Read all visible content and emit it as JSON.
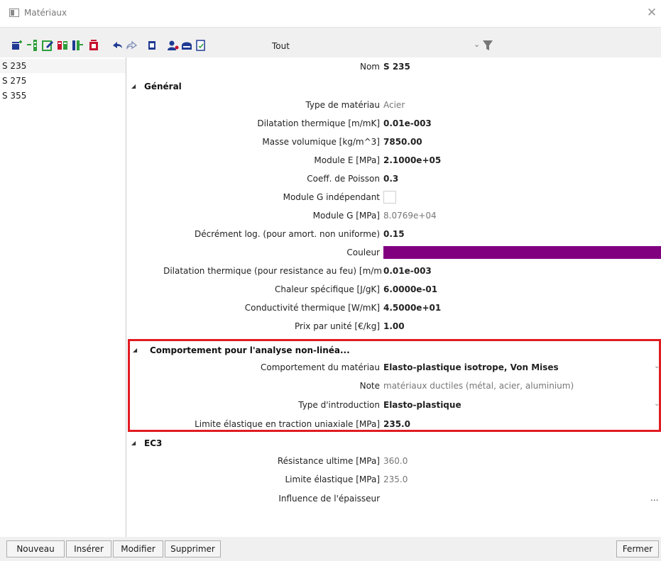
{
  "window": {
    "title": "Matériaux",
    "close_icon": "close-icon"
  },
  "toolbar": {
    "icons": [
      "add-material-icon",
      "insert-icon",
      "edit-icon",
      "copy-icon",
      "append-icon",
      "delete-icon",
      "undo-icon",
      "redo-icon",
      "trash-icon",
      "user-settings-icon",
      "save-icon",
      "document-icon"
    ],
    "filter_value": "Tout"
  },
  "list": {
    "items": [
      "S 235",
      "S 275",
      "S 355"
    ],
    "selected": "S 235"
  },
  "props": {
    "nom": {
      "label": "Nom",
      "value": "S 235"
    },
    "general": {
      "title": "Général",
      "type_materiau": {
        "label": "Type de matériau",
        "value": "Acier"
      },
      "dilatation": {
        "label": "Dilatation thermique  [m/mK]",
        "value": "0.01e-003"
      },
      "masse": {
        "label": "Masse volumique [kg/m^3]",
        "value": "7850.00"
      },
      "module_e": {
        "label": "Module E [MPa]",
        "value": "2.1000e+05"
      },
      "poisson": {
        "label": "Coeff. de Poisson",
        "value": "0.3"
      },
      "g_indep": {
        "label": "Module G indépendant"
      },
      "module_g": {
        "label": "Module G [MPa]",
        "value": "8.0769e+04"
      },
      "decrement": {
        "label": "Décrément log. (pour amort. non uniforme)",
        "value": "0.15"
      },
      "couleur": {
        "label": "Couleur",
        "color": "#800080"
      },
      "dilatation_feu": {
        "label": "Dilatation thermique (pour resistance au feu)  [m/m",
        "value": "0.01e-003"
      },
      "chaleur": {
        "label": "Chaleur spécifique [J/gK]",
        "value": "6.0000e-01"
      },
      "conductivite": {
        "label": "Conductivité thermique [W/mK]",
        "value": "4.5000e+01"
      },
      "prix": {
        "label": "Prix par unité [€/kg]",
        "value": "1.00"
      }
    },
    "nonlin": {
      "title": "Comportement pour l'analyse non-linéa...",
      "comportement": {
        "label": "Comportement du matériau",
        "value": "Elasto-plastique isotrope, Von Mises"
      },
      "note": {
        "label": "Note",
        "value": "matériaux ductiles (métal, acier, aluminium)"
      },
      "type_intro": {
        "label": "Type d'introduction",
        "value": "Elasto-plastique"
      },
      "limite_traction": {
        "label": "Limite élastique en traction uniaxiale [MPa]",
        "value": "235.0"
      }
    },
    "ec3": {
      "title": "EC3",
      "resistance": {
        "label": "Résistance ultime [MPa]",
        "value": "360.0"
      },
      "limite": {
        "label": "Limite élastique [MPa]",
        "value": "235.0"
      },
      "influence": {
        "label": "Influence de l'épaisseur",
        "value": "..."
      }
    }
  },
  "buttons": {
    "nouveau": "Nouveau",
    "inserer": "Insérer",
    "modifier": "Modifier",
    "supprimer": "Supprimer",
    "fermer": "Fermer"
  },
  "colors": {
    "highlight": "#e11b22",
    "accent_red": "#c8102e",
    "accent_green": "#2e9e3a",
    "accent_blue": "#1f3a93"
  }
}
